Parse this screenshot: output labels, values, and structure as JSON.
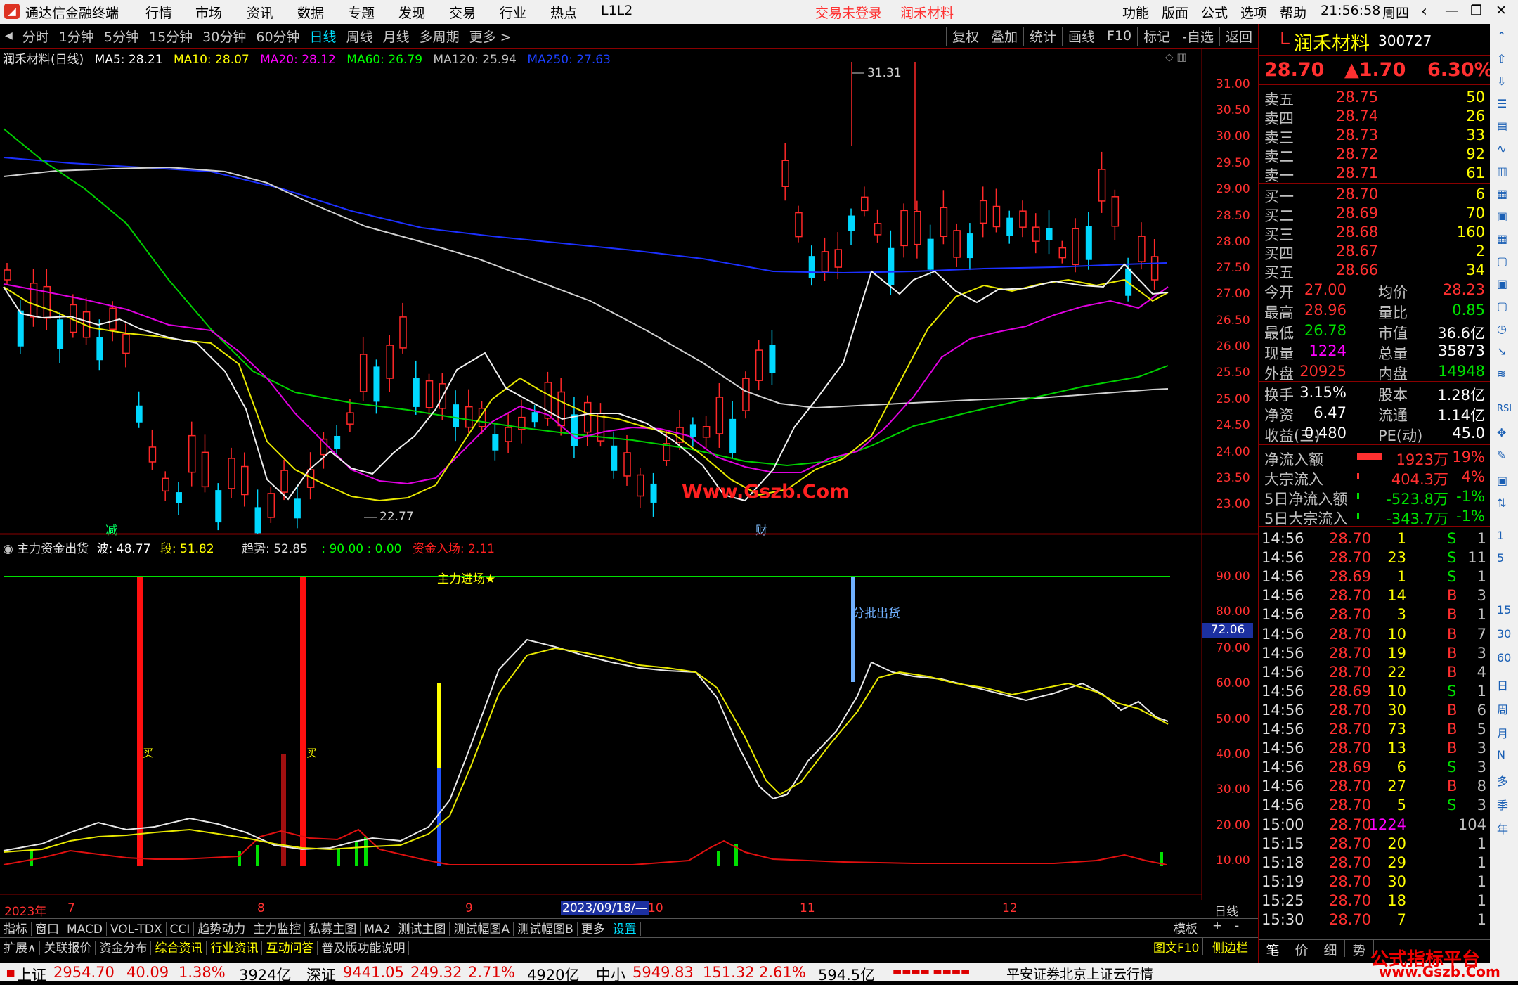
{
  "app": {
    "title": "通达信金融终端",
    "menus": [
      "行情",
      "市场",
      "资讯",
      "数据",
      "专题",
      "发现",
      "交易",
      "行业",
      "热点",
      "L1L2"
    ],
    "login_status": "交易未登录",
    "stock_name_title": "润禾材料",
    "right_menus": [
      "功能",
      "版面",
      "公式",
      "选项",
      "帮助"
    ],
    "time": "21:56:58",
    "weekday": "周四"
  },
  "toolbar": {
    "periods": [
      "分时",
      "1分钟",
      "5分钟",
      "15分钟",
      "30分钟",
      "60分钟",
      "日线",
      "周线",
      "月线",
      "多周期",
      "更多 >"
    ],
    "active_period": "日线",
    "actions": [
      "复权",
      "叠加",
      "统计",
      "画线",
      "F10",
      "标记",
      "-自选",
      "返回"
    ]
  },
  "main_chart": {
    "legend_title": "润禾材料(日线)",
    "ma": [
      {
        "label": "MA5: 28.21",
        "color": "#ffffff"
      },
      {
        "label": "MA10: 28.07",
        "color": "#ffff00"
      },
      {
        "label": "MA20: 28.12",
        "color": "#ff00ff"
      },
      {
        "label": "MA60: 26.79",
        "color": "#00ff00"
      },
      {
        "label": "MA120: 25.94",
        "color": "#c0c0c0"
      },
      {
        "label": "MA250: 27.63",
        "color": "#0040ff"
      }
    ],
    "y_ticks": [
      "31.00",
      "30.50",
      "30.00",
      "29.50",
      "29.00",
      "28.50",
      "28.00",
      "27.50",
      "27.00",
      "26.50",
      "26.00",
      "25.50",
      "25.00",
      "24.50",
      "24.00",
      "23.50",
      "23.00"
    ],
    "high_label": "31.31",
    "low_label": "22.77",
    "watermark": "Www.Gszb.Com",
    "markers": [
      "减",
      "财"
    ]
  },
  "sub_chart": {
    "name": "主力资金出货",
    "wave_label": "波: 48.77",
    "segment_label": "段: 51.82",
    "trend_label": "趋势: 52.85",
    "extra": ": 90.00 : 0.00",
    "fund_label": "资金入场: 2.11",
    "line_label": "主力进场★",
    "sell_label": "分批出货",
    "buy_marks": [
      "买",
      "买"
    ],
    "current_value": "72.06",
    "y_ticks": [
      "90.00",
      "80.00",
      "70.00",
      "60.00",
      "50.00",
      "40.00",
      "30.00",
      "20.00",
      "10.00"
    ]
  },
  "x_axis": {
    "labels": [
      "2023年",
      "7",
      "8",
      "9",
      "10",
      "11",
      "12"
    ],
    "cursor_date": "2023/09/18/—",
    "period": "日线"
  },
  "tabs": {
    "row1": [
      "指标",
      "窗口",
      "MACD",
      "VOL-TDX",
      "CCI",
      "趋势动力",
      "主力监控",
      "私募主图",
      "MA2",
      "测试主图",
      "测试幅图A",
      "测试幅图B",
      "更多",
      "设置"
    ],
    "row1_right": [
      "模板",
      "+",
      "-"
    ],
    "row2": [
      "扩展∧",
      "关联报价",
      "资金分布",
      "综合资讯",
      "行业资讯",
      "互动问答",
      "普及版功能说明"
    ],
    "row2_right": [
      "图文F10",
      "侧边栏 《"
    ]
  },
  "quote": {
    "prefix": "L",
    "name": "润禾材料",
    "code": "300727",
    "price": "28.70",
    "change": "▲1.70",
    "change_pct": "6.30%",
    "asks": [
      {
        "label": "卖五",
        "price": "28.75",
        "vol": "50"
      },
      {
        "label": "卖四",
        "price": "28.74",
        "vol": "26"
      },
      {
        "label": "卖三",
        "price": "28.73",
        "vol": "33"
      },
      {
        "label": "卖二",
        "price": "28.72",
        "vol": "92"
      },
      {
        "label": "卖一",
        "price": "28.71",
        "vol": "61"
      }
    ],
    "bids": [
      {
        "label": "买一",
        "price": "28.70",
        "vol": "6"
      },
      {
        "label": "买二",
        "price": "28.69",
        "vol": "70"
      },
      {
        "label": "买三",
        "price": "28.68",
        "vol": "160"
      },
      {
        "label": "买四",
        "price": "28.67",
        "vol": "2"
      },
      {
        "label": "买五",
        "price": "28.66",
        "vol": "34"
      }
    ],
    "stats": [
      {
        "k1": "今开",
        "v1": "27.00",
        "c1": "#ff3030",
        "k2": "均价",
        "v2": "28.23",
        "c2": "#ff3030"
      },
      {
        "k1": "最高",
        "v1": "28.96",
        "c1": "#ff3030",
        "k2": "量比",
        "v2": "0.85",
        "c2": "#00e000"
      },
      {
        "k1": "最低",
        "v1": "26.78",
        "c1": "#00e000",
        "k2": "市值",
        "v2": "36.6亿",
        "c2": "#ffffff"
      },
      {
        "k1": "现量",
        "v1": "1224",
        "c1": "#ff00ff",
        "k2": "总量",
        "v2": "35873",
        "c2": "#ffffff"
      },
      {
        "k1": "外盘",
        "v1": "20925",
        "c1": "#ff3030",
        "k2": "内盘",
        "v2": "14948",
        "c2": "#00e000"
      }
    ],
    "stats2": [
      {
        "k1": "换手",
        "v1": "3.15%",
        "k2": "股本",
        "v2": "1.28亿"
      },
      {
        "k1": "净资",
        "v1": "6.47",
        "k2": "流通",
        "v2": "1.14亿"
      },
      {
        "k1": "收益(三)",
        "v1": "0.480",
        "k2": "PE(动)",
        "v2": "45.0"
      }
    ],
    "flows": [
      {
        "label": "净流入额",
        "value": "1923万",
        "pct": "19%",
        "color": "#ff3030",
        "bar": 70
      },
      {
        "label": "大宗流入",
        "value": "404.3万",
        "pct": "4%",
        "color": "#ff3030",
        "bar": 6
      },
      {
        "label": "5日净流入额",
        "value": "-523.8万",
        "pct": "-1%",
        "color": "#00e000",
        "bar": 6
      },
      {
        "label": "5日大宗流入",
        "value": "-343.7万",
        "pct": "-1%",
        "color": "#00e000",
        "bar": 6
      }
    ],
    "ticks": [
      {
        "t": "14:56",
        "p": "28.70",
        "v": "1",
        "s": "S",
        "n": "1"
      },
      {
        "t": "14:56",
        "p": "28.70",
        "v": "23",
        "s": "S",
        "n": "11"
      },
      {
        "t": "14:56",
        "p": "28.69",
        "v": "1",
        "s": "S",
        "n": "1"
      },
      {
        "t": "14:56",
        "p": "28.70",
        "v": "14",
        "s": "B",
        "n": "3"
      },
      {
        "t": "14:56",
        "p": "28.70",
        "v": "3",
        "s": "B",
        "n": "1"
      },
      {
        "t": "14:56",
        "p": "28.70",
        "v": "10",
        "s": "B",
        "n": "7"
      },
      {
        "t": "14:56",
        "p": "28.70",
        "v": "19",
        "s": "B",
        "n": "3"
      },
      {
        "t": "14:56",
        "p": "28.70",
        "v": "22",
        "s": "B",
        "n": "4"
      },
      {
        "t": "14:56",
        "p": "28.69",
        "v": "10",
        "s": "S",
        "n": "1"
      },
      {
        "t": "14:56",
        "p": "28.70",
        "v": "30",
        "s": "B",
        "n": "6"
      },
      {
        "t": "14:56",
        "p": "28.70",
        "v": "73",
        "s": "B",
        "n": "5"
      },
      {
        "t": "14:56",
        "p": "28.70",
        "v": "13",
        "s": "B",
        "n": "3"
      },
      {
        "t": "14:56",
        "p": "28.69",
        "v": "6",
        "s": "S",
        "n": "3"
      },
      {
        "t": "14:56",
        "p": "28.70",
        "v": "27",
        "s": "B",
        "n": "8"
      },
      {
        "t": "14:56",
        "p": "28.70",
        "v": "5",
        "s": "S",
        "n": "3"
      },
      {
        "t": "15:00",
        "p": "28.70",
        "v": "1224",
        "s": "",
        "n": "104"
      },
      {
        "t": "15:15",
        "p": "28.70",
        "v": "20",
        "s": "",
        "n": "1"
      },
      {
        "t": "15:18",
        "p": "28.70",
        "v": "29",
        "s": "",
        "n": "1"
      },
      {
        "t": "15:19",
        "p": "28.70",
        "v": "30",
        "s": "",
        "n": "1"
      },
      {
        "t": "15:25",
        "p": "28.70",
        "v": "18",
        "s": "",
        "n": "1"
      },
      {
        "t": "15:30",
        "p": "28.70",
        "v": "7",
        "s": "",
        "n": "1"
      }
    ],
    "bottom_tabs": [
      "笔",
      "价",
      "细",
      "势"
    ]
  },
  "sidebar": {
    "labels": [
      "15",
      "30",
      "60",
      "日",
      "周",
      "月",
      "N",
      "多",
      "季",
      "年"
    ]
  },
  "status": {
    "sh": {
      "name": "上证",
      "value": "2954.70",
      "chg": "40.09",
      "pct": "1.38%",
      "amt": "3924亿"
    },
    "sz": {
      "name": "深证",
      "value": "9441.05",
      "chg": "249.32",
      "pct": "2.71%",
      "amt": "4920亿"
    },
    "zx": {
      "name": "中小",
      "value": "5949.83",
      "chg": "151.32",
      "pct": "2.61%",
      "amt": "594.5亿"
    },
    "server": "平安证券北京上证云行情",
    "watermark": "公式指标平台",
    "watermark_url": "www.Gszb.Com"
  }
}
